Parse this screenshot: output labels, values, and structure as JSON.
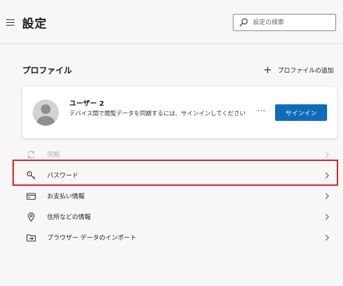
{
  "header": {
    "title": "設定",
    "search_placeholder": "設定の検索",
    "menu_icon": "hamburger-icon",
    "search_icon": "search-icon"
  },
  "profile": {
    "section_title": "プロファイル",
    "add_profile_label": "プロファイルの追加",
    "user_name": "ユーザー 2",
    "signin_message": "デバイス間で閲覧データを同期するには、サインインしてください",
    "more_label": "…",
    "signin_label": "サインイン"
  },
  "menu": {
    "items": [
      {
        "label": "同期",
        "icon": "sync-icon"
      },
      {
        "label": "パスワード",
        "icon": "key-icon"
      },
      {
        "label": "お支払い情報",
        "icon": "credit-card-icon"
      },
      {
        "label": "住所などの情報",
        "icon": "location-pin-icon"
      },
      {
        "label": "ブラウザー データのインポート",
        "icon": "import-icon"
      }
    ]
  },
  "colors": {
    "accent": "#0f6cbd",
    "highlight": "#e0201f",
    "background": "#f7f7f7"
  }
}
